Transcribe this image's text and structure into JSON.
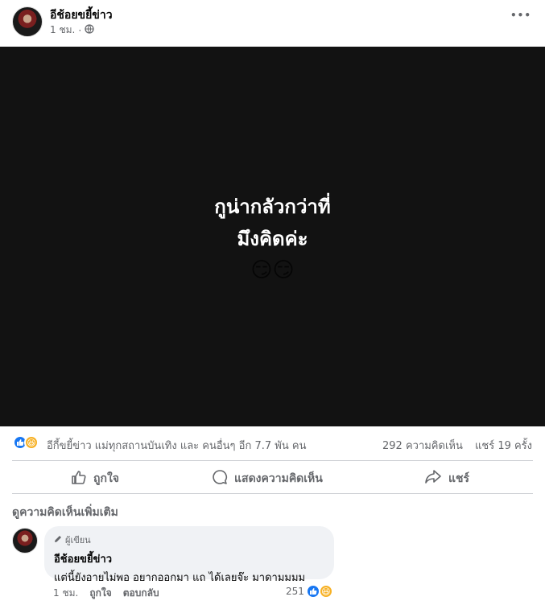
{
  "post": {
    "page_name": "อีช้อยขยี้ข่าว",
    "time": "1 ชม.",
    "separator": "·",
    "more_label": "•••"
  },
  "media": {
    "line1": "กูน่ากลัวกว่าที่",
    "line2": "มึงคิดค่ะ",
    "emoji": "😏😏"
  },
  "reactions": {
    "summary": "อีกี้ขยี้ข่าว แม่ทุกสถานบันเทิง และ คนอื่นๆ อีก 7.7 พัน คน",
    "comments_count": "292 ความคิดเห็น",
    "shares_count": "แชร์ 19 ครั้ง"
  },
  "actions": {
    "like": "ถูกใจ",
    "comment": "แสดงความคิดเห็น",
    "share": "แชร์"
  },
  "comments_section": {
    "view_more": "ดูความคิดเห็นเพิ่มเติม"
  },
  "comment": {
    "badge": "ผู้เขียน",
    "name": "อีช้อยขยี้ข่าว",
    "text": "แต่นี้ยังอายไม่พอ อยากออกมา แถ ได้เลยจ๊ะ มาดามมมม",
    "time": "1 ชม.",
    "like": "ถูกใจ",
    "reply": "ตอบกลับ",
    "reaction_count": "251"
  },
  "colors": {
    "brand_blue": "#1877f2",
    "haha_yellow": "#f7b125",
    "media_bg": "#121212",
    "secondary_text": "#65676b"
  }
}
